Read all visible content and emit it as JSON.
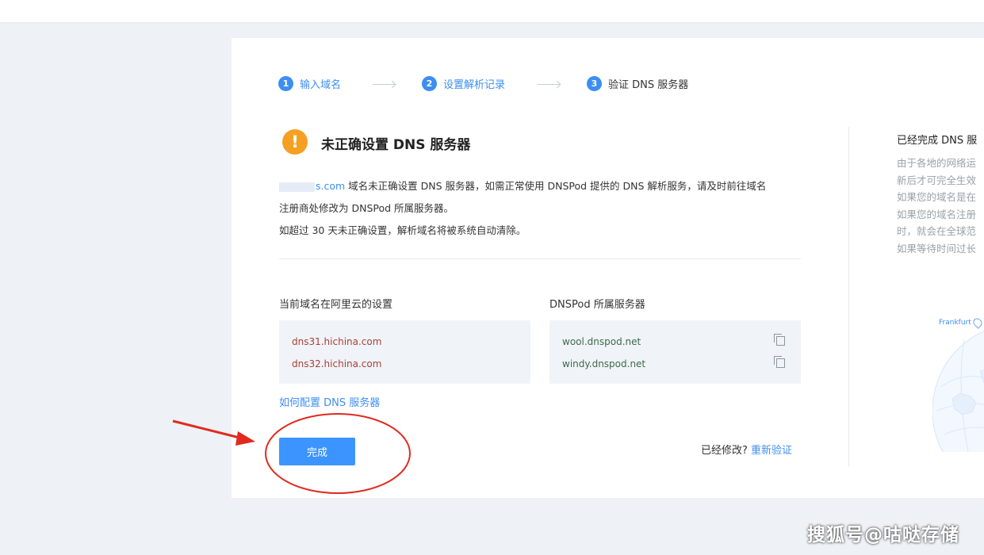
{
  "steps": [
    {
      "num": "1",
      "label": "输入域名",
      "state": "done"
    },
    {
      "num": "2",
      "label": "设置解析记录",
      "state": "done"
    },
    {
      "num": "3",
      "label": "验证 DNS 服务器",
      "state": "active"
    }
  ],
  "status": {
    "icon": "warning-icon",
    "title": "未正确设置 DNS 服务器"
  },
  "description": {
    "domain_suffix": "s.com",
    "line1_rest": " 域名未正确设置 DNS 服务器，如需正常使用 DNSPod 提供的 DNS 解析服务，请及时前往域名",
    "line2": "注册商处修改为 DNSPod 所属服务器。",
    "line3": "如超过 30 天未正确设置，解析域名将被系统自动清除。"
  },
  "current": {
    "title": "当前域名在阿里云的设置",
    "servers": [
      "dns31.hichina.com",
      "dns32.hichina.com"
    ]
  },
  "dnspod": {
    "title": "DNSPod 所属服务器",
    "servers": [
      "wool.dnspod.net",
      "windy.dnspod.net"
    ]
  },
  "help_link": "如何配置 DNS 服务器",
  "done_button": "完成",
  "modified": {
    "question": "已经修改?",
    "reverify": "重新验证"
  },
  "side": {
    "title": "已经完成 DNS 服",
    "lines": [
      "由于各地的网络运",
      "新后才可完全生效",
      "如果您的域名是在",
      "如果您的域名注册",
      "时，就会在全球范",
      "如果等待时间过长"
    ],
    "map_label": "Frankfurt"
  },
  "watermark": "搜狐号@咕哒存储",
  "colors": {
    "accent": "#3d8ef2",
    "warning": "#f5a023",
    "annotation_red": "#e02a1f"
  }
}
